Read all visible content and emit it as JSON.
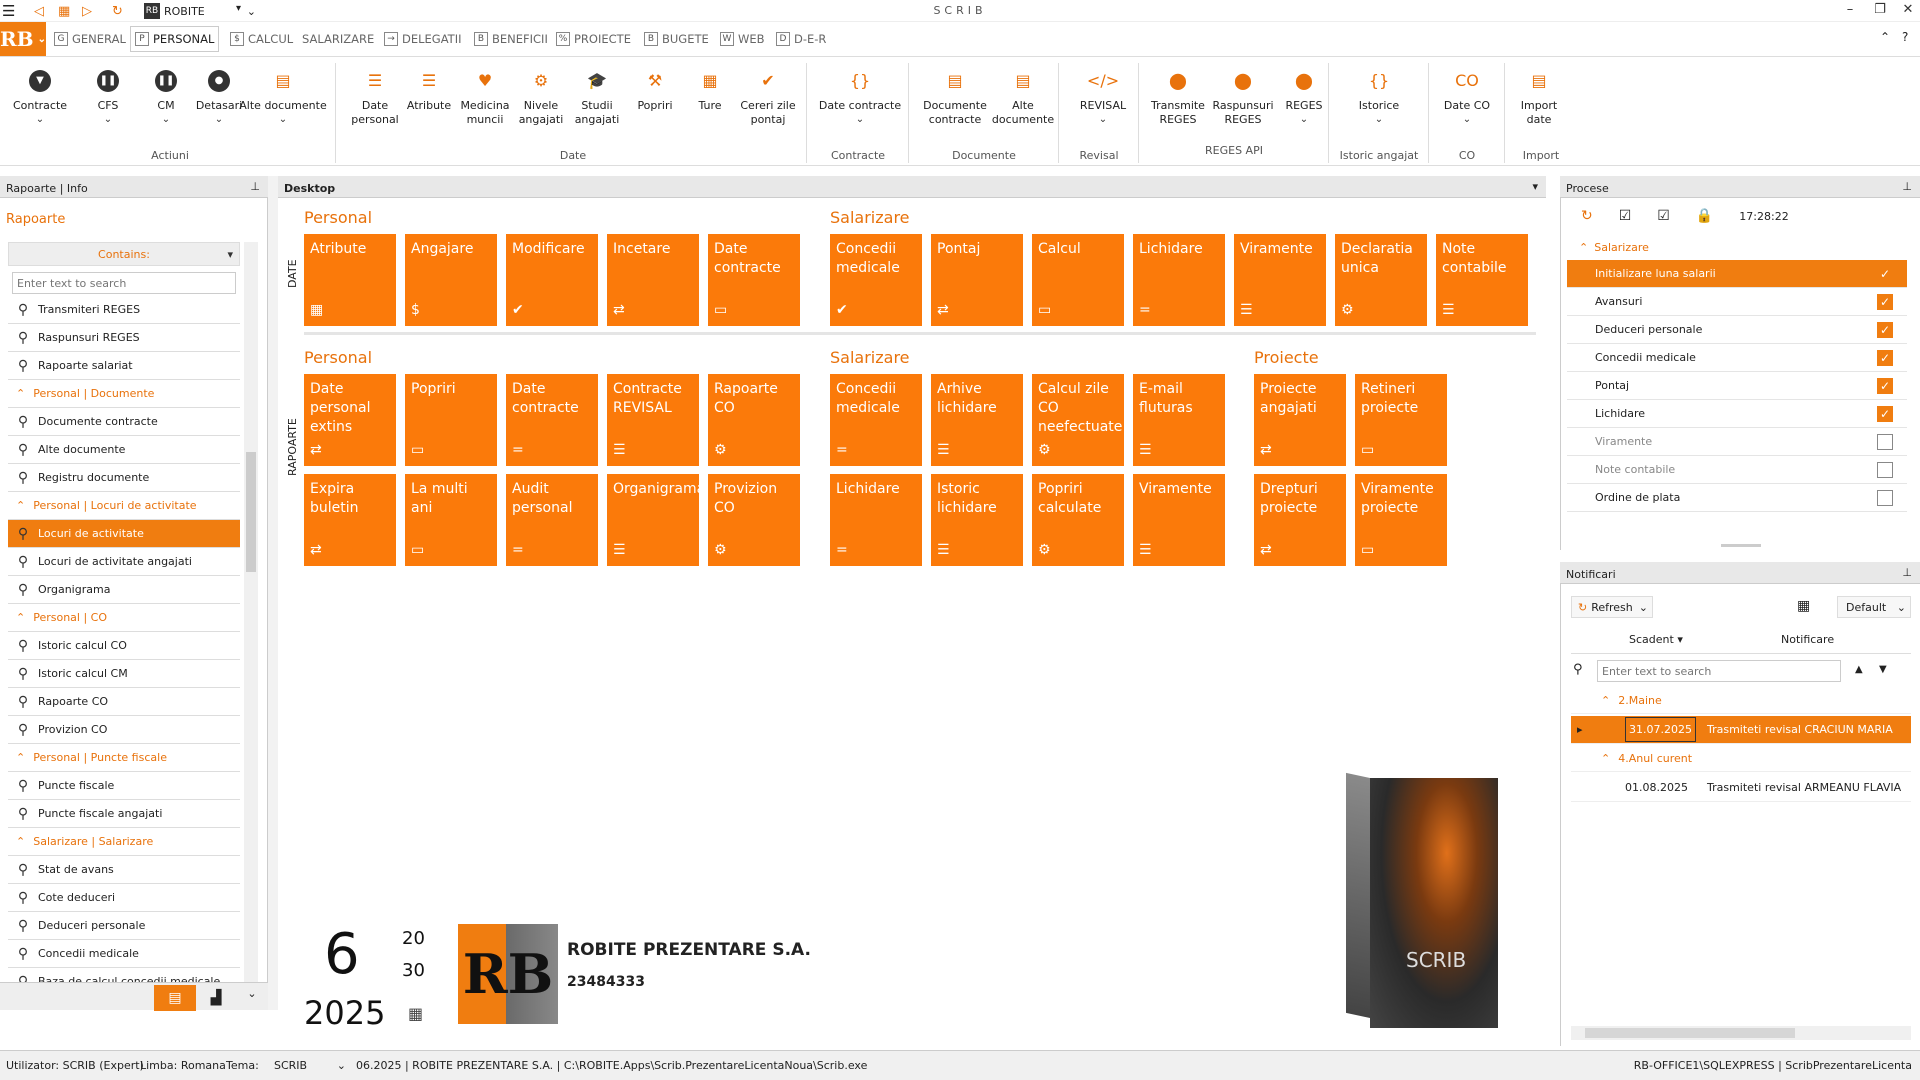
{
  "app": {
    "title": "SCRIB",
    "company_combo": "ROBITE"
  },
  "tabs": [
    {
      "label": "GENERAL",
      "icon": "G"
    },
    {
      "label": "PERSONAL",
      "icon": "P"
    },
    {
      "label": "CALCUL",
      "icon": "$"
    },
    {
      "label": "SALARIZARE",
      "icon": ""
    },
    {
      "label": "DELEGATII",
      "icon": "→"
    },
    {
      "label": "BENEFICII",
      "icon": "B"
    },
    {
      "label": "PROIECTE",
      "icon": "%"
    },
    {
      "label": "BUGETE",
      "icon": "B"
    },
    {
      "label": "WEB",
      "icon": "W"
    },
    {
      "label": "D-E-R",
      "icon": "D"
    }
  ],
  "ribbon": {
    "buttons": [
      {
        "label": "Contracte",
        "icon": "▼"
      },
      {
        "label": "CFS",
        "icon": "❚❚"
      },
      {
        "label": "CM",
        "icon": "❚❚"
      },
      {
        "label": "Detasari",
        "icon": "●"
      },
      {
        "label": "Alte documente",
        "icon": "▤"
      },
      {
        "label": "Date\npersonal",
        "icon": "☰"
      },
      {
        "label": "Atribute",
        "icon": "☰"
      },
      {
        "label": "Medicina\nmuncii",
        "icon": "♥"
      },
      {
        "label": "Nivele\nangajati",
        "icon": "⚙"
      },
      {
        "label": "Studii\nangajati",
        "icon": "🎓"
      },
      {
        "label": "Popriri",
        "icon": "⚒"
      },
      {
        "label": "Ture",
        "icon": "▦"
      },
      {
        "label": "Cereri zile\npontaj",
        "icon": "✔"
      },
      {
        "label": "Date contracte",
        "icon": "{}"
      },
      {
        "label": "Documente\ncontracte",
        "icon": "▤"
      },
      {
        "label": "Alte\ndocumente",
        "icon": "▤"
      },
      {
        "label": "REVISAL",
        "icon": "</>"
      },
      {
        "label": "Transmite\nREGES",
        "icon": "⬤"
      },
      {
        "label": "Raspunsuri\nREGES",
        "icon": "⬤"
      },
      {
        "label": "REGES",
        "icon": "⬤"
      },
      {
        "label": "Istorice",
        "icon": "{}"
      },
      {
        "label": "Date CO",
        "icon": "CO"
      },
      {
        "label": "Import\ndate",
        "icon": "▤"
      }
    ],
    "groups": [
      "Actiuni",
      "Date",
      "Contracte",
      "Documente",
      "Revisal",
      "REGES API",
      "Istoric angajat",
      "CO",
      "Import"
    ]
  },
  "left": {
    "header": "Rapoarte | Info",
    "title": "Rapoarte",
    "filter_label": "Contains:",
    "search_placeholder": "Enter text to search",
    "rows": [
      {
        "type": "item",
        "label": "Transmiteri REGES"
      },
      {
        "type": "item",
        "label": "Raspunsuri REGES"
      },
      {
        "type": "item",
        "label": "Rapoarte salariat"
      },
      {
        "type": "group",
        "label": "Personal | Documente"
      },
      {
        "type": "item",
        "label": "Documente contracte"
      },
      {
        "type": "item",
        "label": "Alte documente"
      },
      {
        "type": "item",
        "label": "Registru documente"
      },
      {
        "type": "group",
        "label": "Personal | Locuri de activitate"
      },
      {
        "type": "item",
        "label": "Locuri de activitate",
        "selected": true
      },
      {
        "type": "item",
        "label": "Locuri de activitate angajati"
      },
      {
        "type": "item",
        "label": "Organigrama"
      },
      {
        "type": "group",
        "label": "Personal | CO"
      },
      {
        "type": "item",
        "label": "Istoric calcul CO"
      },
      {
        "type": "item",
        "label": "Istoric calcul CM"
      },
      {
        "type": "item",
        "label": "Rapoarte CO"
      },
      {
        "type": "item",
        "label": "Provizion CO"
      },
      {
        "type": "group",
        "label": "Personal | Puncte fiscale"
      },
      {
        "type": "item",
        "label": "Puncte fiscale"
      },
      {
        "type": "item",
        "label": "Puncte fiscale angajati"
      },
      {
        "type": "group",
        "label": "Salarizare | Salarizare"
      },
      {
        "type": "item",
        "label": "Stat de avans"
      },
      {
        "type": "item",
        "label": "Cote deduceri"
      },
      {
        "type": "item",
        "label": "Deduceri personale"
      },
      {
        "type": "item",
        "label": "Concedii medicale"
      },
      {
        "type": "item",
        "label": "Baza de calcul concedii medicale"
      }
    ]
  },
  "desktop": {
    "tab": "Desktop",
    "vlabel_top": "DATE",
    "vlabel_bottom": "RAPOARTE",
    "sections": {
      "personal_top": "Personal",
      "salarizare_top": "Salarizare",
      "personal_bottom": "Personal",
      "salarizare_bottom": "Salarizare",
      "proiecte_bottom": "Proiecte"
    },
    "tiles_top_personal": [
      "Atribute",
      "Angajare",
      "Modificare",
      "Incetare",
      "Date contracte"
    ],
    "tiles_top_salarizare": [
      "Concedii medicale",
      "Pontaj",
      "Calcul",
      "Lichidare",
      "Viramente",
      "Declaratia unica",
      "Note contabile"
    ],
    "tiles_bot_personal_r1": [
      "Date personal extins",
      "Popriri",
      "Date contracte",
      "Contracte REVISAL",
      "Rapoarte CO"
    ],
    "tiles_bot_personal_r2": [
      "Expira buletin",
      "La multi ani",
      "Audit personal",
      "Organigrama",
      "Provizion CO"
    ],
    "tiles_bot_salarizare_r1": [
      "Concedii medicale",
      "Arhive lichidare",
      "Calcul zile CO neefectuate",
      "E-mail fluturas"
    ],
    "tiles_bot_salarizare_r2": [
      "Lichidare",
      "Istoric lichidare",
      "Popriri calculate",
      "Viramente"
    ],
    "tiles_bot_proiecte_r1": [
      "Proiecte angajati",
      "Retineri proiecte"
    ],
    "tiles_bot_proiecte_r2": [
      "Drepturi proiecte",
      "Viramente proiecte"
    ],
    "period": {
      "month": "6",
      "year": "2025",
      "days_worked": "20",
      "days_total": "30"
    },
    "company": {
      "name": "ROBITE PREZENTARE S.A.",
      "code": "23484333",
      "logo_text": "RB"
    },
    "box_text": "SCRIB"
  },
  "procese": {
    "header": "Procese",
    "time": "17:28:22",
    "group": "Salarizare",
    "items": [
      {
        "label": "Initializare luna salarii",
        "checked": true,
        "selected": true
      },
      {
        "label": "Avansuri",
        "checked": true
      },
      {
        "label": "Deduceri personale",
        "checked": true
      },
      {
        "label": "Concedii medicale",
        "checked": true
      },
      {
        "label": "Pontaj",
        "checked": true
      },
      {
        "label": "Lichidare",
        "checked": true
      },
      {
        "label": "Viramente",
        "checked": false
      },
      {
        "label": "Note contabile",
        "checked": false
      },
      {
        "label": "Ordine de plata",
        "checked": false
      }
    ]
  },
  "notificari": {
    "header": "Notificari",
    "refresh": "Refresh",
    "layout": "Default",
    "col_scadent": "Scadent",
    "col_notificare": "Notificare",
    "search_placeholder": "Enter text to search",
    "groups": [
      {
        "label": "2.Maine",
        "rows": [
          {
            "date": "31.07.2025",
            "text": "Trasmiteti revisal CRACIUN MARIA",
            "selected": true
          }
        ]
      },
      {
        "label": "4.Anul curent",
        "rows": [
          {
            "date": "01.08.2025",
            "text": "Trasmiteti revisal ARMEANU FLAVIA",
            "selected": false
          }
        ]
      }
    ]
  },
  "status": {
    "user": "Utilizator: SCRIB (Expert)",
    "lang": "Limba: Romana",
    "theme_label": "Tema:",
    "theme": "SCRIB",
    "info": "06.2025 | ROBITE PREZENTARE S.A. | C:\\ROBITE.Apps\\Scrib.PrezentareLicentaNoua\\Scrib.exe",
    "server": "RB-OFFICE1\\SQLEXPRESS | ScribPrezentareLicenta"
  },
  "colors": {
    "accent": "#f07d10",
    "tile": "#fb7a0a"
  }
}
